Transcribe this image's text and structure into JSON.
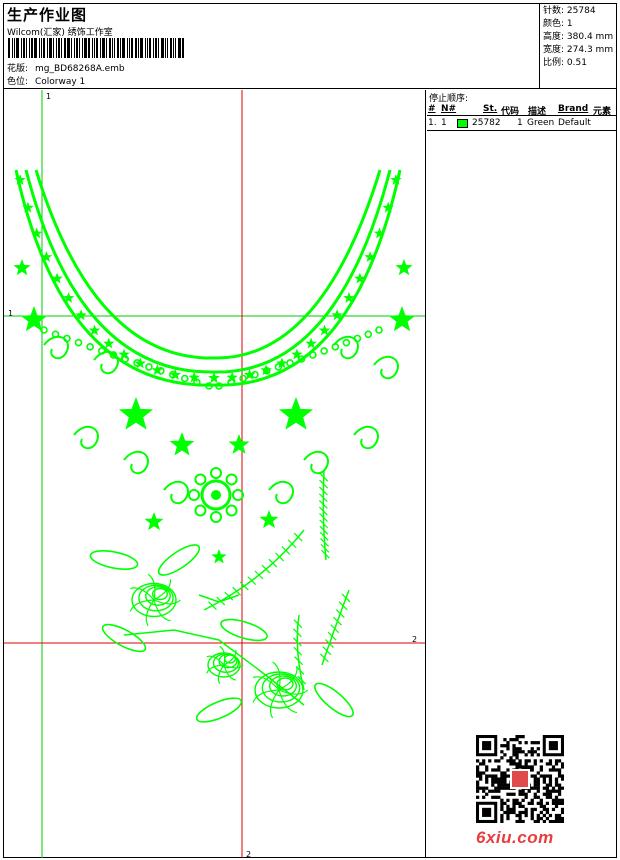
{
  "header": {
    "title": "生产作业图",
    "subtitle": "Wilcom(汇家) 绣饰工作室",
    "pattern_label": "花版:",
    "pattern_value": "mg_BD68268A.emb",
    "colorway_label": "色位:",
    "colorway_value": "Colorway 1"
  },
  "stats": {
    "stitches_label": "针数:",
    "stitches_value": "25784",
    "colors_label": "颜色:",
    "colors_value": "1",
    "height_label": "高度:",
    "height_value": "380.4 mm",
    "width_label": "宽度:",
    "width_value": "274.3 mm",
    "scale_label": "比例:",
    "scale_value": "0.51"
  },
  "design": {
    "guide_h_left_label": "1",
    "guide_top_label": "1",
    "guide_h_right_label": "2",
    "guide_bottom_label": "2",
    "thread_color": "#00ff00",
    "guide_green": "#00cc00",
    "guide_red": "#dd0000"
  },
  "sequence": {
    "title": "停止顺序:",
    "headers": {
      "num": "#",
      "no": "N#",
      "st": "St.",
      "code": "代码",
      "desc": "描述",
      "brand": "Brand",
      "element": "元素"
    },
    "rows": [
      {
        "num": "1.",
        "no": "1",
        "st": "25782",
        "code": "1",
        "desc": "Green",
        "brand": "Default",
        "color": "#00ff00"
      }
    ]
  },
  "watermark": "6xiu.com"
}
